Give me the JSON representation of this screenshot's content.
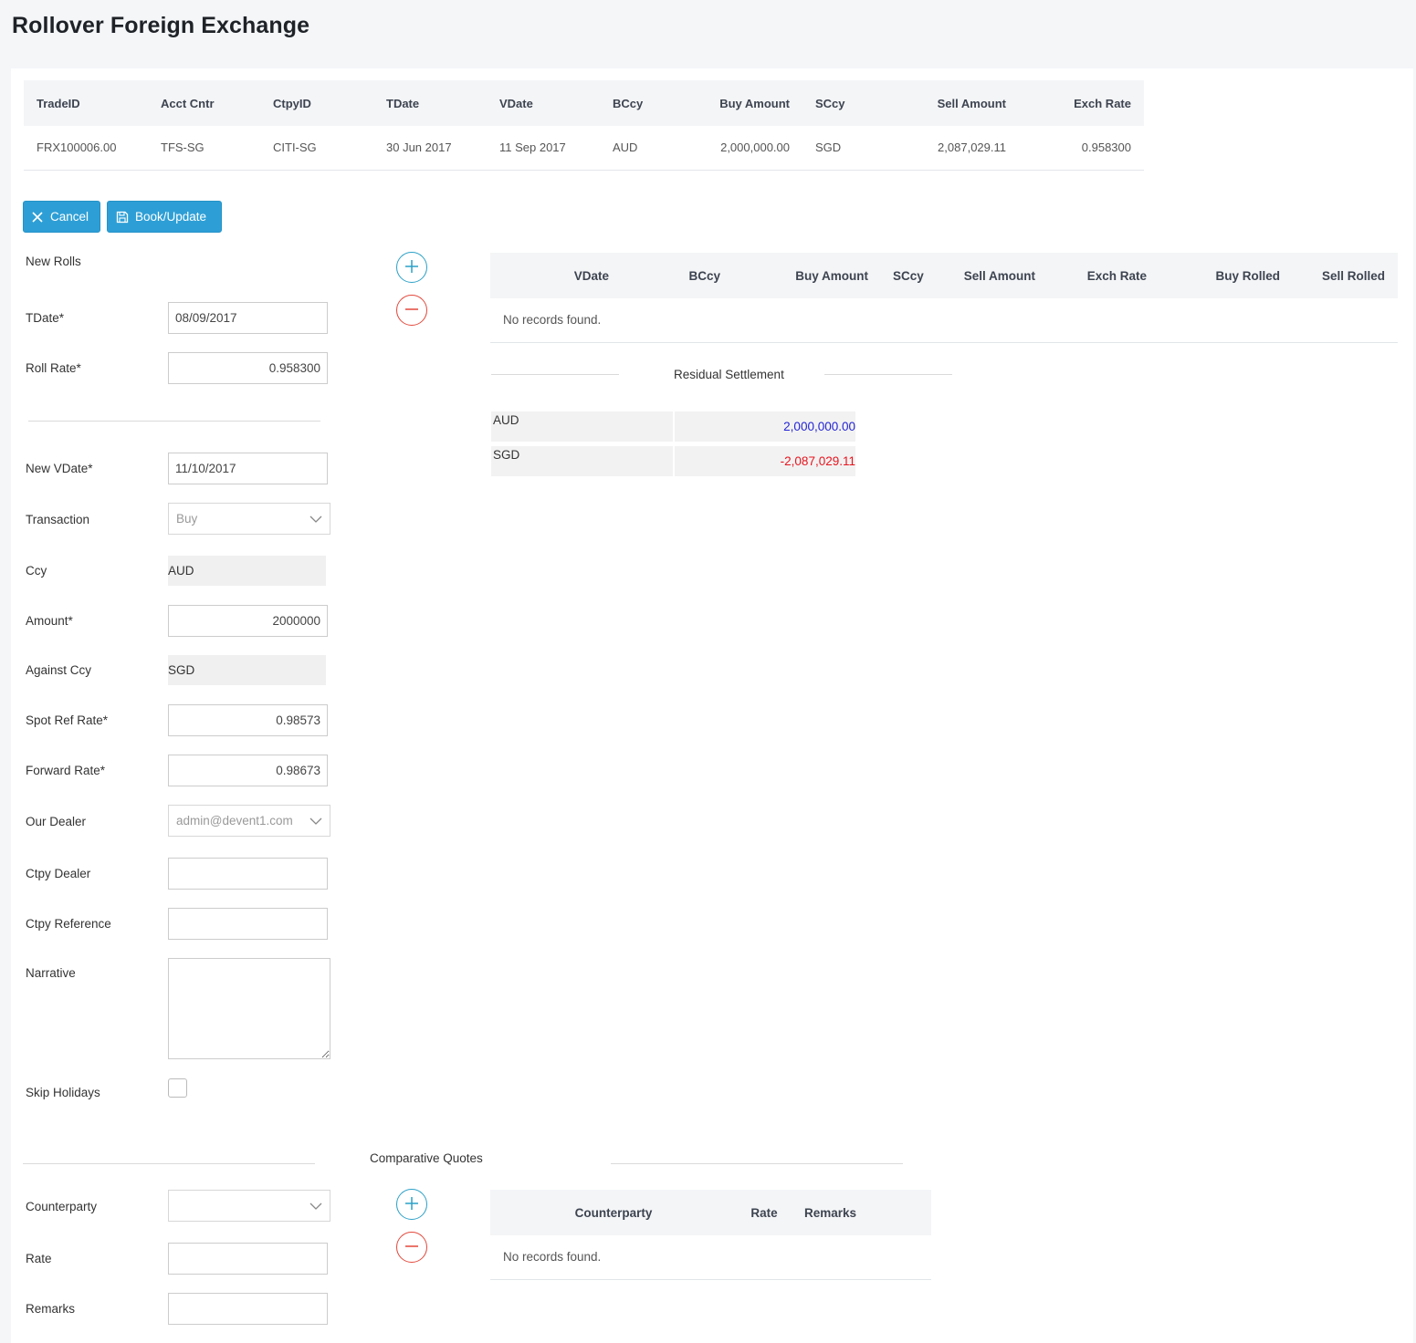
{
  "page": {
    "title": "Rollover Foreign Exchange"
  },
  "trade_table": {
    "headers": [
      "TradeID",
      "Acct Cntr",
      "CtpyID",
      "TDate",
      "VDate",
      "BCcy",
      "Buy Amount",
      "SCcy",
      "Sell Amount",
      "Exch Rate"
    ],
    "rows": [
      [
        "FRX100006.00",
        "TFS-SG",
        "CITI-SG",
        "30 Jun 2017",
        "11 Sep 2017",
        "AUD",
        "2,000,000.00",
        "SGD",
        "2,087,029.11",
        "0.958300"
      ]
    ]
  },
  "toolbar": {
    "cancel_label": "Cancel",
    "book_label": "Book/Update"
  },
  "form": {
    "new_rolls_label": "New Rolls",
    "tdate_label": "TDate*",
    "tdate_value": "08/09/2017",
    "roll_rate_label": "Roll Rate*",
    "roll_rate_value": "0.958300",
    "new_vdate_label": "New VDate*",
    "new_vdate_value": "11/10/2017",
    "transaction_label": "Transaction",
    "transaction_value": "Buy",
    "ccy_label": "Ccy",
    "ccy_value": "AUD",
    "amount_label": "Amount*",
    "amount_value": "2000000",
    "against_ccy_label": "Against Ccy",
    "against_ccy_value": "SGD",
    "spot_ref_rate_label": "Spot Ref Rate*",
    "spot_ref_rate_value": "0.98573",
    "forward_rate_label": "Forward Rate*",
    "forward_rate_value": "0.98673",
    "our_dealer_label": "Our Dealer",
    "our_dealer_value": "admin@devent1.com",
    "ctpy_dealer_label": "Ctpy Dealer",
    "ctpy_dealer_value": "",
    "ctpy_reference_label": "Ctpy Reference",
    "ctpy_reference_value": "",
    "narrative_label": "Narrative",
    "narrative_value": "",
    "skip_holidays_label": "Skip Holidays"
  },
  "rolls_table": {
    "headers": [
      "VDate",
      "BCcy",
      "Buy Amount",
      "SCcy",
      "Sell Amount",
      "Exch Rate",
      "Buy Rolled",
      "Sell Rolled"
    ],
    "empty_message": "No records found."
  },
  "residual": {
    "caption": "Residual Settlement",
    "rows": [
      {
        "ccy": "AUD",
        "amount": "2,000,000.00",
        "color": "#2424d6"
      },
      {
        "ccy": "SGD",
        "amount": "-2,087,029.11",
        "color": "#e8141e"
      }
    ]
  },
  "quotes": {
    "caption": "Comparative Quotes",
    "counterparty_label": "Counterparty",
    "counterparty_value": "",
    "rate_label": "Rate",
    "rate_value": "",
    "remarks_label": "Remarks",
    "remarks_value": "",
    "table_headers": [
      "Counterparty",
      "Rate",
      "Remarks"
    ],
    "empty_message": "No records found."
  },
  "colors": {
    "accent": "#2e9fd6",
    "add": "#2aa0c7",
    "remove": "#e2473a"
  },
  "icons": {
    "cancel": "close-icon",
    "book": "save-icon",
    "add": "plus-circle-icon",
    "remove": "minus-circle-icon",
    "dropdown": "chevron-down-icon"
  }
}
